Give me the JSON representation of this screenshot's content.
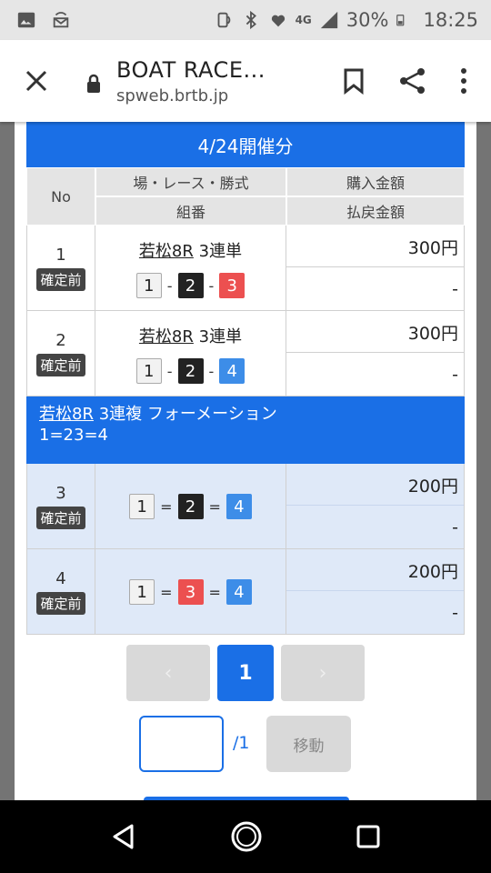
{
  "status_bar": {
    "network": "4G",
    "battery": "30%",
    "time": "18:25"
  },
  "toolbar": {
    "title": "BOAT RACE...",
    "url": "spweb.brtb.jp"
  },
  "banner": "4/24開催分",
  "table_header": {
    "no": "No",
    "col1_top": "場・レース・勝式",
    "col1_bottom": "組番",
    "col2_top": "購入金額",
    "col2_bottom": "払戻金額"
  },
  "rows": [
    {
      "no": "1",
      "status": "確定前",
      "race": "若松8R",
      "type": " 3連単",
      "combo": [
        "1",
        "2",
        "3"
      ],
      "sep": "-",
      "amount": "300円",
      "refund": "-"
    },
    {
      "no": "2",
      "status": "確定前",
      "race": "若松8R",
      "type": " 3連単",
      "combo": [
        "1",
        "2",
        "4"
      ],
      "sep": "-",
      "amount": "300円",
      "refund": "-"
    },
    {
      "no": "3",
      "status": "確定前",
      "combo": [
        "1",
        "2",
        "4"
      ],
      "sep": "=",
      "amount": "200円",
      "refund": "-"
    },
    {
      "no": "4",
      "status": "確定前",
      "combo": [
        "1",
        "3",
        "4"
      ],
      "sep": "=",
      "amount": "200円",
      "refund": "-"
    }
  ],
  "formation": {
    "race": "若松8R",
    "label": " 3連複 フォーメーション",
    "combo": "1=23=4"
  },
  "pager": {
    "prev": "‹",
    "current": "1",
    "next": "›"
  },
  "jump": {
    "value": "",
    "total": "/1",
    "button": "移動"
  },
  "colors": {
    "accent": "#1a6fe6",
    "boat1": "#f2f2f2",
    "boat2": "#222222",
    "boat3": "#ec5050",
    "boat4": "#3d8de8"
  }
}
